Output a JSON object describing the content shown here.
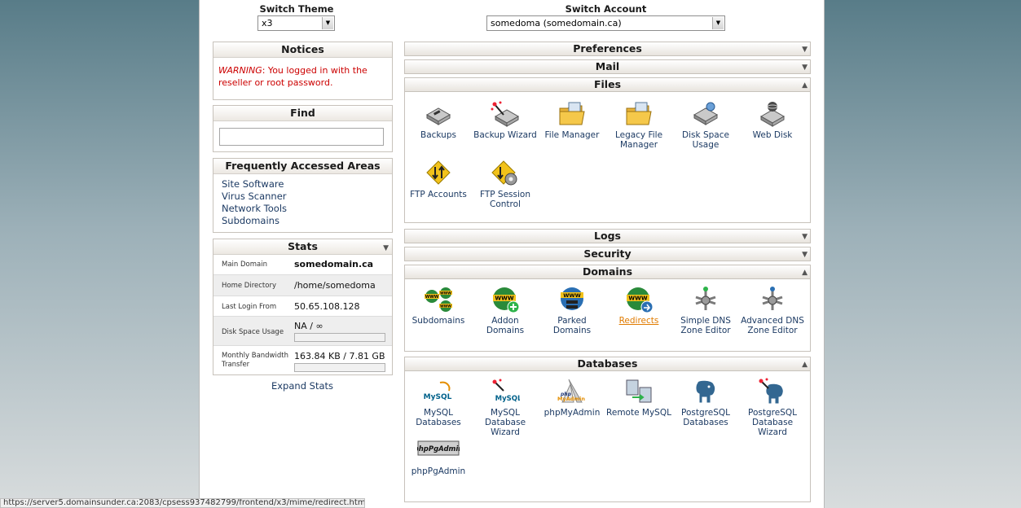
{
  "switch_theme": {
    "label": "Switch Theme",
    "value": "x3"
  },
  "switch_account": {
    "label": "Switch Account",
    "value": "somedoma (somedomain.ca)"
  },
  "notices": {
    "title": "Notices",
    "warning_prefix": "WARNING",
    "warning_text": ": You logged in with the reseller or root password."
  },
  "find": {
    "title": "Find",
    "value": ""
  },
  "frequent": {
    "title": "Frequently Accessed Areas",
    "items": [
      "Site Software",
      "Virus Scanner",
      "Network Tools",
      "Subdomains"
    ]
  },
  "stats": {
    "title": "Stats",
    "main_domain_key": "Main Domain",
    "main_domain": "somedomain.ca",
    "home_dir_key": "Home Directory",
    "home_dir": "/home/somedoma",
    "last_login_key": "Last Login From",
    "last_login": "50.65.108.128",
    "disk_key": "Disk Space Usage",
    "disk": "NA / ∞",
    "disk_fraction": 0,
    "bandwidth_key": "Monthly Bandwidth Transfer",
    "bandwidth": "163.84 KB / 7.81 GB",
    "bandwidth_fraction": 0,
    "expand": "Expand Stats"
  },
  "sections": {
    "preferences": "Preferences",
    "mail": "Mail",
    "files": "Files",
    "logs": "Logs",
    "security": "Security",
    "domains": "Domains",
    "databases": "Databases"
  },
  "files_items": [
    "Backups",
    "Backup Wizard",
    "File Manager",
    "Legacy File Manager",
    "Disk Space Usage",
    "Web Disk",
    "FTP Accounts",
    "FTP Session Control"
  ],
  "domains_items": [
    "Subdomains",
    "Addon Domains",
    "Parked Domains",
    "Redirects",
    "Simple DNS Zone Editor",
    "Advanced DNS Zone Editor"
  ],
  "databases_items": [
    "MySQL Databases",
    "MySQL Database Wizard",
    "phpMyAdmin",
    "Remote MySQL",
    "PostgreSQL Databases",
    "PostgreSQL Database Wizard",
    "phpPgAdmin"
  ],
  "icon_text": {
    "www": "WWW",
    "mysql": "MySQL",
    "php": "php",
    "myadmin": "MyAdmin",
    "phppgadmin": "phpPgAdmin"
  },
  "status_url": "https://server5.domainsunder.ca:2083/cpsess937482799/frontend/x3/mime/redirect.html",
  "colors": {
    "link": "#1c3a63",
    "warning": "#cc0000",
    "highlight": "#e07b00"
  }
}
